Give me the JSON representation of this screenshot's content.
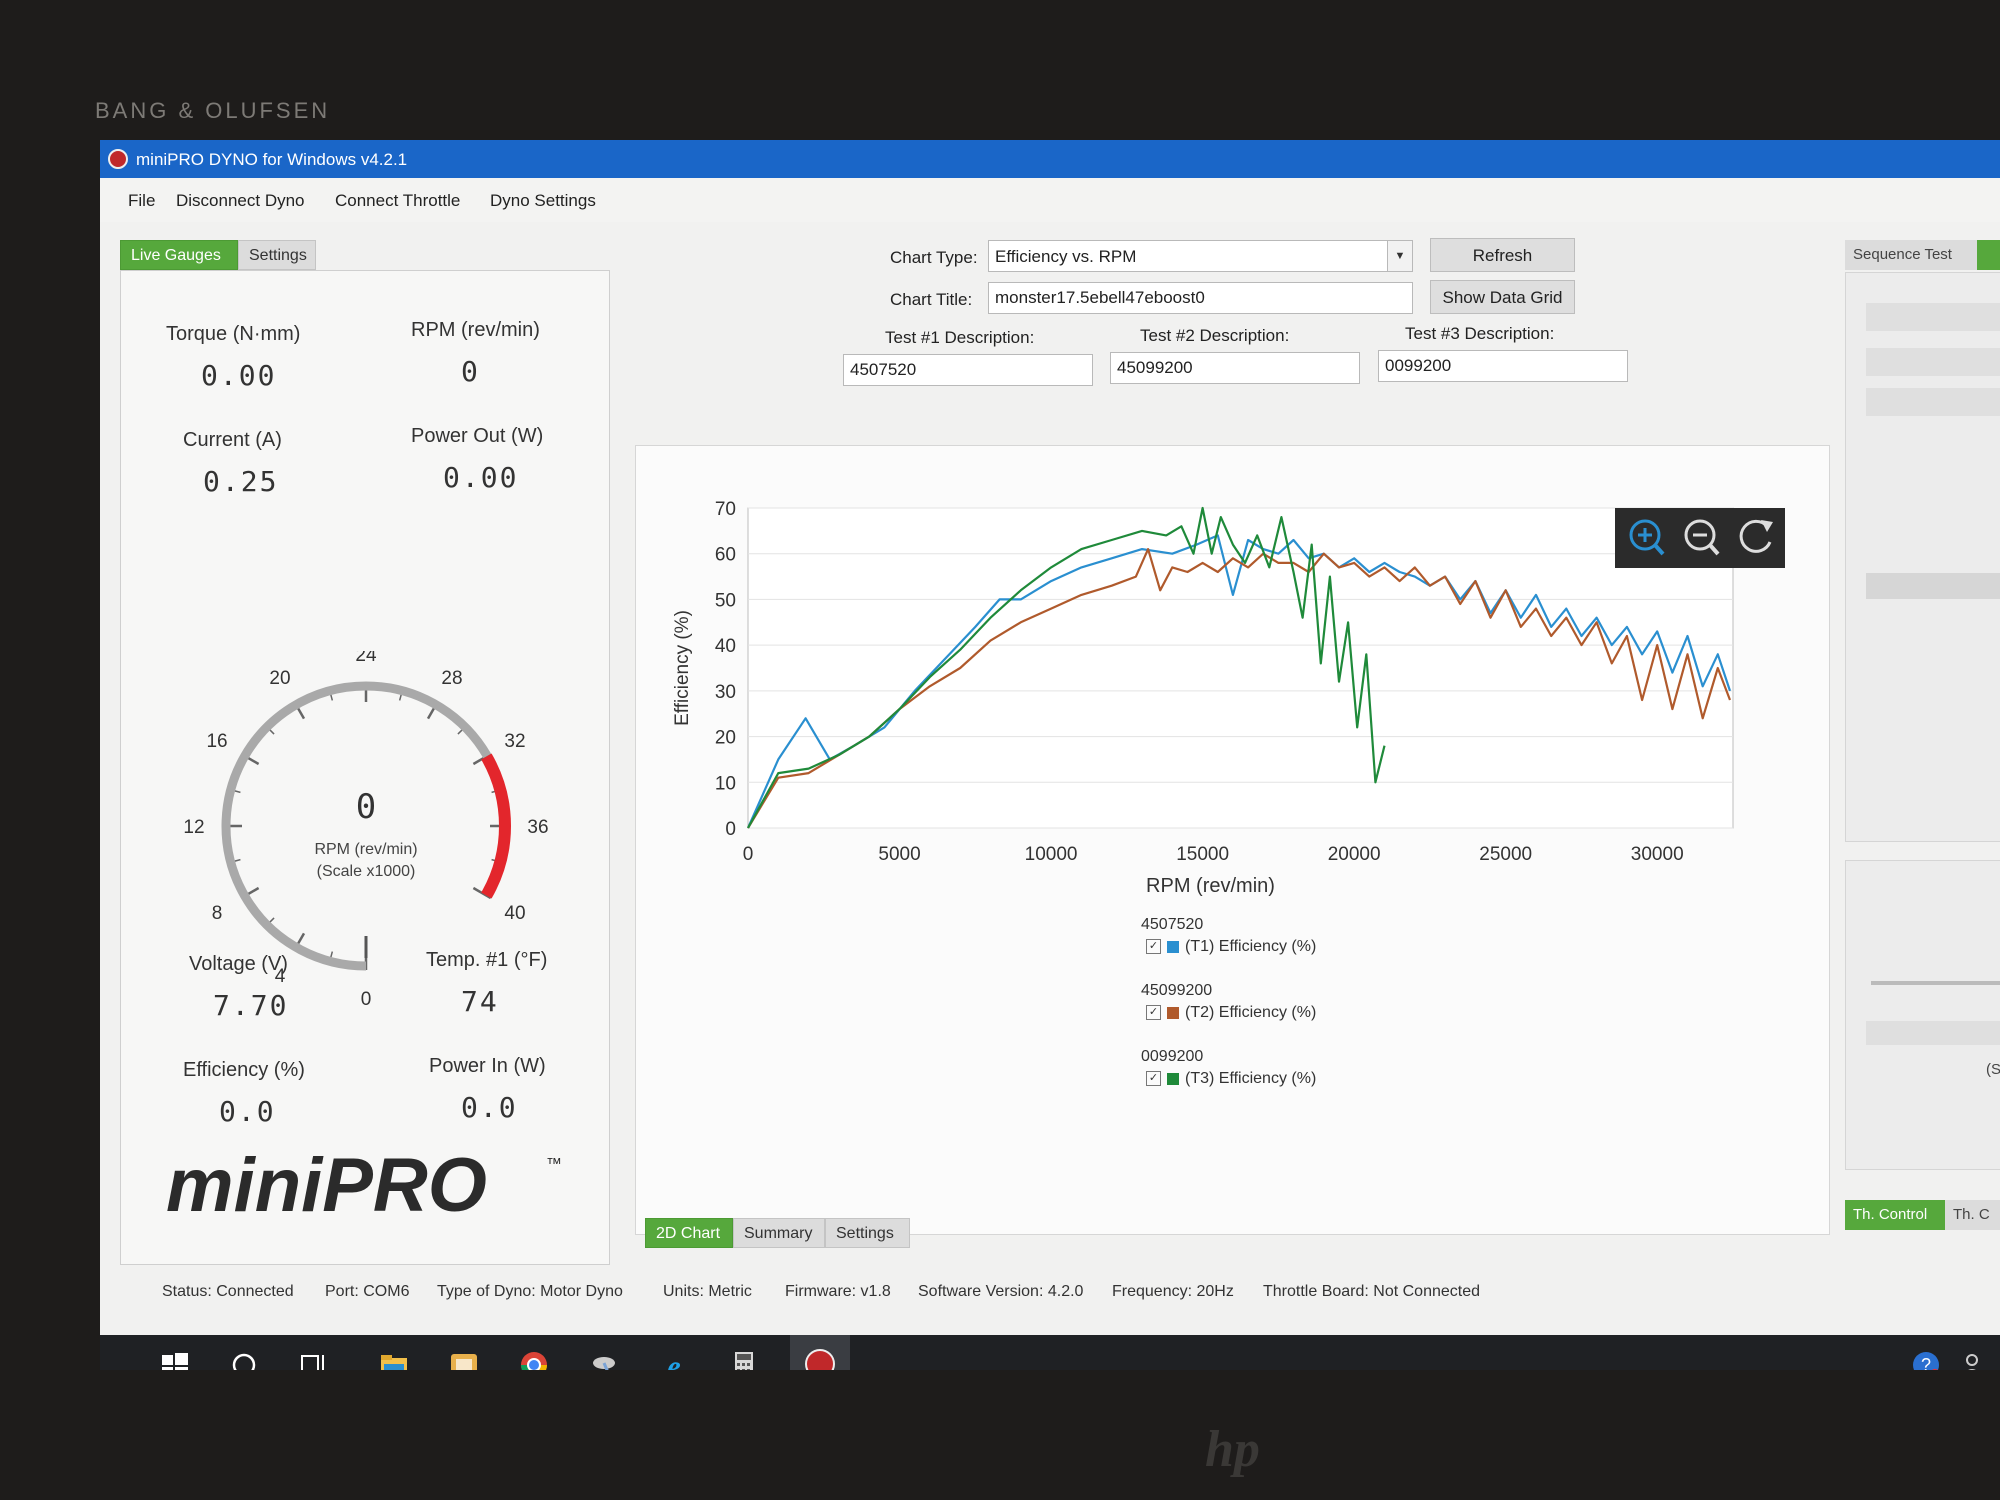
{
  "bezel": {
    "brand": "BANG & OLUFSEN",
    "logo": "hp"
  },
  "window": {
    "title": "miniPRO DYNO for Windows v4.2.1",
    "icon": "dyno-app-icon"
  },
  "menu": [
    "File",
    "Disconnect Dyno",
    "Connect Throttle",
    "Dyno Settings"
  ],
  "left_tabs": [
    "Live Gauges",
    "Settings"
  ],
  "gauges": {
    "torque": {
      "label": "Torque  (N·mm)",
      "value": "0.00"
    },
    "rpm": {
      "label": "RPM  (rev/min)",
      "value": "0"
    },
    "current": {
      "label": "Current  (A)",
      "value": "0.25"
    },
    "power_out": {
      "label": "Power Out  (W)",
      "value": "0.00"
    },
    "voltage": {
      "label": "Voltage  (V)",
      "value": "7.70"
    },
    "temp": {
      "label": "Temp. #1  (°F)",
      "value": "74"
    },
    "efficiency": {
      "label": "Efficiency  (%)",
      "value": "0.0"
    },
    "power_in": {
      "label": "Power In  (W)",
      "value": "0.0"
    }
  },
  "dial": {
    "value": "0",
    "level": 0,
    "unit": "RPM  (rev/min)",
    "scale": "(Scale x1000)",
    "ticks": [
      "0",
      "4",
      "8",
      "12",
      "16",
      "20",
      "24",
      "28",
      "32",
      "36",
      "40"
    ],
    "max": 40,
    "redline_start": 32,
    "colors": {
      "arc": "#a9a9a9",
      "redline": "#e3262c"
    }
  },
  "logo": {
    "text": "miniPRO",
    "tm": "™"
  },
  "controls": {
    "chart_type_label": "Chart Type:",
    "chart_type_value": "Efficiency vs. RPM",
    "chart_title_label": "Chart Title:",
    "chart_title_value": "monster17.5ebell47eboost0",
    "refresh": "Refresh",
    "show_grid": "Show Data Grid",
    "test1_label": "Test #1 Description:",
    "test1_value": "4507520",
    "test2_label": "Test #2 Description:",
    "test2_value": "45099200",
    "test3_label": "Test #3 Description:",
    "test3_value": "0099200"
  },
  "chart_data": {
    "type": "line",
    "xlabel": "RPM (rev/min)",
    "ylabel": "Efficiency (%)",
    "xlim": [
      0,
      32500
    ],
    "ylim": [
      0,
      70
    ],
    "xticks": [
      0,
      5000,
      10000,
      15000,
      20000,
      25000,
      30000
    ],
    "yticks": [
      0,
      10,
      20,
      30,
      40,
      50,
      60,
      70
    ],
    "grid": "horizontal",
    "legend": "below",
    "series": [
      {
        "name": "(T1) Efficiency (%)",
        "group": "4507520",
        "color": "#2a8fd0",
        "x": [
          0,
          1000,
          1900,
          2700,
          3500,
          4500,
          5500,
          6500,
          7500,
          8300,
          9000,
          10000,
          11000,
          12000,
          13000,
          14000,
          14800,
          15500,
          16000,
          16500,
          17000,
          17500,
          18000,
          18500,
          19000,
          19500,
          20000,
          20500,
          21000,
          21500,
          22000,
          22500,
          23000,
          23500,
          24000,
          24500,
          25000,
          25500,
          26000,
          26500,
          27000,
          27500,
          28000,
          28500,
          29000,
          29500,
          30000,
          30500,
          31000,
          31500,
          32000,
          32400
        ],
        "y": [
          0,
          15,
          24,
          15,
          18,
          22,
          30,
          37,
          44,
          50,
          50,
          54,
          57,
          59,
          61,
          60,
          62,
          64,
          51,
          63,
          61,
          60,
          63,
          59,
          60,
          57,
          59,
          56,
          58,
          56,
          55,
          53,
          55,
          50,
          54,
          47,
          52,
          46,
          51,
          44,
          48,
          42,
          46,
          40,
          44,
          38,
          43,
          34,
          42,
          31,
          38,
          30
        ]
      },
      {
        "name": "(T2) Efficiency (%)",
        "group": "45099200",
        "color": "#b05a2c",
        "x": [
          0,
          1000,
          2000,
          3000,
          4000,
          5000,
          6000,
          7000,
          8000,
          9000,
          10000,
          11000,
          12000,
          12800,
          13200,
          13600,
          14000,
          14500,
          15000,
          15500,
          16000,
          16500,
          17000,
          17500,
          18000,
          18500,
          19000,
          19500,
          20000,
          20500,
          21000,
          21500,
          22000,
          22500,
          23000,
          23500,
          24000,
          24500,
          25000,
          25500,
          26000,
          26500,
          27000,
          27500,
          28000,
          28500,
          29000,
          29500,
          30000,
          30500,
          31000,
          31500,
          32000,
          32400
        ],
        "y": [
          0,
          11,
          12,
          16,
          20,
          26,
          31,
          35,
          41,
          45,
          48,
          51,
          53,
          55,
          61,
          52,
          57,
          56,
          58,
          56,
          59,
          57,
          60,
          58,
          58,
          56,
          60,
          57,
          58,
          55,
          57,
          54,
          57,
          53,
          55,
          49,
          54,
          46,
          52,
          44,
          48,
          42,
          46,
          40,
          45,
          36,
          42,
          28,
          40,
          26,
          38,
          24,
          35,
          28
        ]
      },
      {
        "name": "(T3) Efficiency (%)",
        "group": "0099200",
        "color": "#1f8a3a",
        "x": [
          0,
          1000,
          2000,
          3000,
          4000,
          5000,
          6000,
          7000,
          8000,
          9000,
          10000,
          11000,
          12000,
          13000,
          13800,
          14300,
          14700,
          15000,
          15300,
          15600,
          16000,
          16400,
          16800,
          17200,
          17600,
          18000,
          18300,
          18600,
          18900,
          19200,
          19500,
          19800,
          20100,
          20400,
          20700,
          21000
        ],
        "y": [
          0,
          12,
          13,
          16,
          20,
          26,
          33,
          39,
          46,
          52,
          57,
          61,
          63,
          65,
          64,
          66,
          60,
          70,
          60,
          68,
          62,
          58,
          64,
          57,
          68,
          56,
          46,
          62,
          36,
          55,
          32,
          45,
          22,
          38,
          10,
          18
        ]
      }
    ]
  },
  "chart_tabs": [
    "2D Chart",
    "Summary",
    "Settings"
  ],
  "zoom_icons": [
    "zoom-in-icon",
    "zoom-out-icon",
    "reset-icon"
  ],
  "right_panel": {
    "tab_top": "Sequence Test",
    "tab_bottom1": "Th. Control",
    "tab_bottom2": "Th. C",
    "partial_text": "(S"
  },
  "status": {
    "status": "Status: Connected",
    "port": "Port: COM6",
    "dyno_type": "Type of Dyno: Motor Dyno",
    "units": "Units: Metric",
    "firmware": "Firmware: v1.8",
    "software": "Software Version: 4.2.0",
    "frequency": "Frequency: 20Hz",
    "throttle": "Throttle Board: Not Connected"
  },
  "taskbar": [
    "windows-start-icon",
    "cortana-icon",
    "task-view-icon",
    "file-explorer-icon",
    "outlook-icon",
    "chrome-icon",
    "satellite-icon",
    "internet-explorer-icon",
    "calculator-icon",
    "dyno-app-icon"
  ],
  "tray": [
    "help-icon",
    "people-icon"
  ]
}
